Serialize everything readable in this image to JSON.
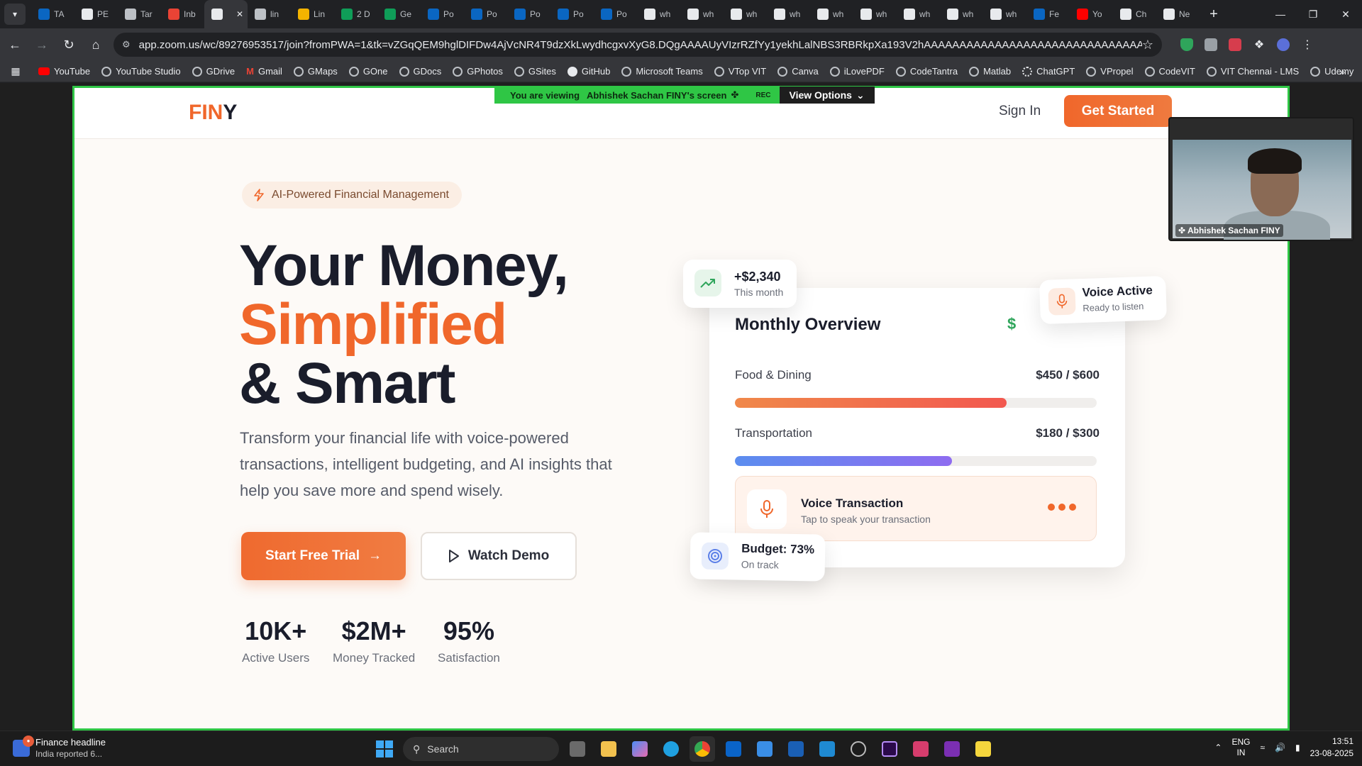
{
  "browser": {
    "tabs": [
      {
        "label": "TA",
        "icon": "linkedin-icon",
        "color": "#0a66c2"
      },
      {
        "label": "PE",
        "icon": "github-icon",
        "color": "#e8eaed"
      },
      {
        "label": "Tar",
        "icon": "globe-icon",
        "color": "#bdc1c6"
      },
      {
        "label": "Inb",
        "icon": "gmail-icon",
        "color": "#ea4335"
      },
      {
        "label": "",
        "icon": "zoom-audio-icon",
        "color": "#e8eaed",
        "active": true
      },
      {
        "label": "lin",
        "icon": "globe-icon",
        "color": "#bdc1c6"
      },
      {
        "label": "Lin",
        "icon": "dots-icon",
        "color": "#f4b400"
      },
      {
        "label": "2 D",
        "icon": "sheets-icon",
        "color": "#0f9d58"
      },
      {
        "label": "Ge",
        "icon": "sheets-icon",
        "color": "#0f9d58"
      },
      {
        "label": "Po",
        "icon": "linkedin-icon",
        "color": "#0a66c2"
      },
      {
        "label": "Po",
        "icon": "linkedin-icon",
        "color": "#0a66c2"
      },
      {
        "label": "Po",
        "icon": "linkedin-icon",
        "color": "#0a66c2"
      },
      {
        "label": "Po",
        "icon": "linkedin-icon",
        "color": "#0a66c2"
      },
      {
        "label": "Po",
        "icon": "linkedin-icon",
        "color": "#0a66c2"
      },
      {
        "label": "wh",
        "icon": "google-icon",
        "color": "#e8eaed"
      },
      {
        "label": "wh",
        "icon": "google-icon",
        "color": "#e8eaed"
      },
      {
        "label": "wh",
        "icon": "google-icon",
        "color": "#e8eaed"
      },
      {
        "label": "wh",
        "icon": "google-icon",
        "color": "#e8eaed"
      },
      {
        "label": "wh",
        "icon": "google-icon",
        "color": "#e8eaed"
      },
      {
        "label": "wh",
        "icon": "google-icon",
        "color": "#e8eaed"
      },
      {
        "label": "wh",
        "icon": "google-icon",
        "color": "#e8eaed"
      },
      {
        "label": "wh",
        "icon": "google-icon",
        "color": "#e8eaed"
      },
      {
        "label": "wh",
        "icon": "google-icon",
        "color": "#e8eaed"
      },
      {
        "label": "Fe",
        "icon": "linkedin-icon",
        "color": "#0a66c2"
      },
      {
        "label": "Yo",
        "icon": "youtube-icon",
        "color": "#ff0000"
      },
      {
        "label": "Ch",
        "icon": "chatgpt-icon",
        "color": "#e8eaed"
      },
      {
        "label": "Ne",
        "icon": "globe-icon",
        "color": "#e8eaed"
      }
    ],
    "url": "app.zoom.us/wc/89276953517/join?fromPWA=1&tk=vZGqQEM9hglDIFDw4AjVcNR4T9dzXkLwydhcgxvXyG8.DQgAAAAUyVIzrRZfYy1yekhLalNBS3RBRkpXa193V2hAAAAAAAAAAAAAAAAAAAAAAAAAAAAAAAAAAAAAAAAAA&_x_zm_r...",
    "bookmarks": [
      "YouTube",
      "YouTube Studio",
      "GDrive",
      "Gmail",
      "GMaps",
      "GOne",
      "GDocs",
      "GPhotos",
      "GSites",
      "GitHub",
      "Microsoft Teams",
      "VTop VIT",
      "Canva",
      "iLovePDF",
      "CodeTantra",
      "Matlab",
      "ChatGPT",
      "VPropel",
      "CodeVIT",
      "VIT Chennai - LMS",
      "Udemy"
    ]
  },
  "share": {
    "viewing_prefix": "You are viewing",
    "presenter": "Abhishek Sachan FINY's screen",
    "rec": "REC",
    "view_options": "View Options"
  },
  "page": {
    "logo": {
      "part1": "FIN",
      "part2": "Y"
    },
    "nav": {
      "sign_in": "Sign In",
      "get_started": "Get Started"
    },
    "badge": "AI-Powered Financial Management",
    "headline": {
      "line1": "Your Money,",
      "line2": "Simplified",
      "line3": "& Smart"
    },
    "description": "Transform your financial life with voice-powered transactions, intelligent budgeting, and AI insights that help you save more and spend wisely.",
    "cta": {
      "trial": "Start Free Trial",
      "demo": "Watch Demo"
    },
    "stats": [
      {
        "value": "10K+",
        "label": "Active Users"
      },
      {
        "value": "$2M+",
        "label": "Money Tracked"
      },
      {
        "value": "95%",
        "label": "Satisfaction"
      }
    ],
    "overview": {
      "title": "Monthly Overview",
      "currency_symbol": "$",
      "rows": [
        {
          "label": "Food & Dining",
          "value": "$450 / $600",
          "progress": 0.75,
          "color_from": "#f0884a",
          "color_to": "#f2584f"
        },
        {
          "label": "Transportation",
          "value": "$180 / $300",
          "progress": 0.6,
          "color_from": "#5b8def",
          "color_to": "#8e6cf0"
        }
      ],
      "voice_tx": {
        "title": "Voice Transaction",
        "subtitle": "Tap to speak your transaction"
      }
    },
    "float_income": {
      "value": "+$2,340",
      "sub": "This month"
    },
    "float_voice": {
      "value": "Voice Active",
      "sub": "Ready to listen"
    },
    "float_budget": {
      "value": "Budget: 73%",
      "sub": "On track"
    },
    "colors": {
      "accent": "#f0672b",
      "dark": "#1a1d2b",
      "success": "#2fc645"
    }
  },
  "video": {
    "name": "Abhishek Sachan FINY"
  },
  "taskbar": {
    "news_title": "Finance headline",
    "news_sub": "India reported 6...",
    "search": "Search",
    "lang": "ENG",
    "region": "IN",
    "time": "13:51",
    "date": "23-08-2025"
  }
}
